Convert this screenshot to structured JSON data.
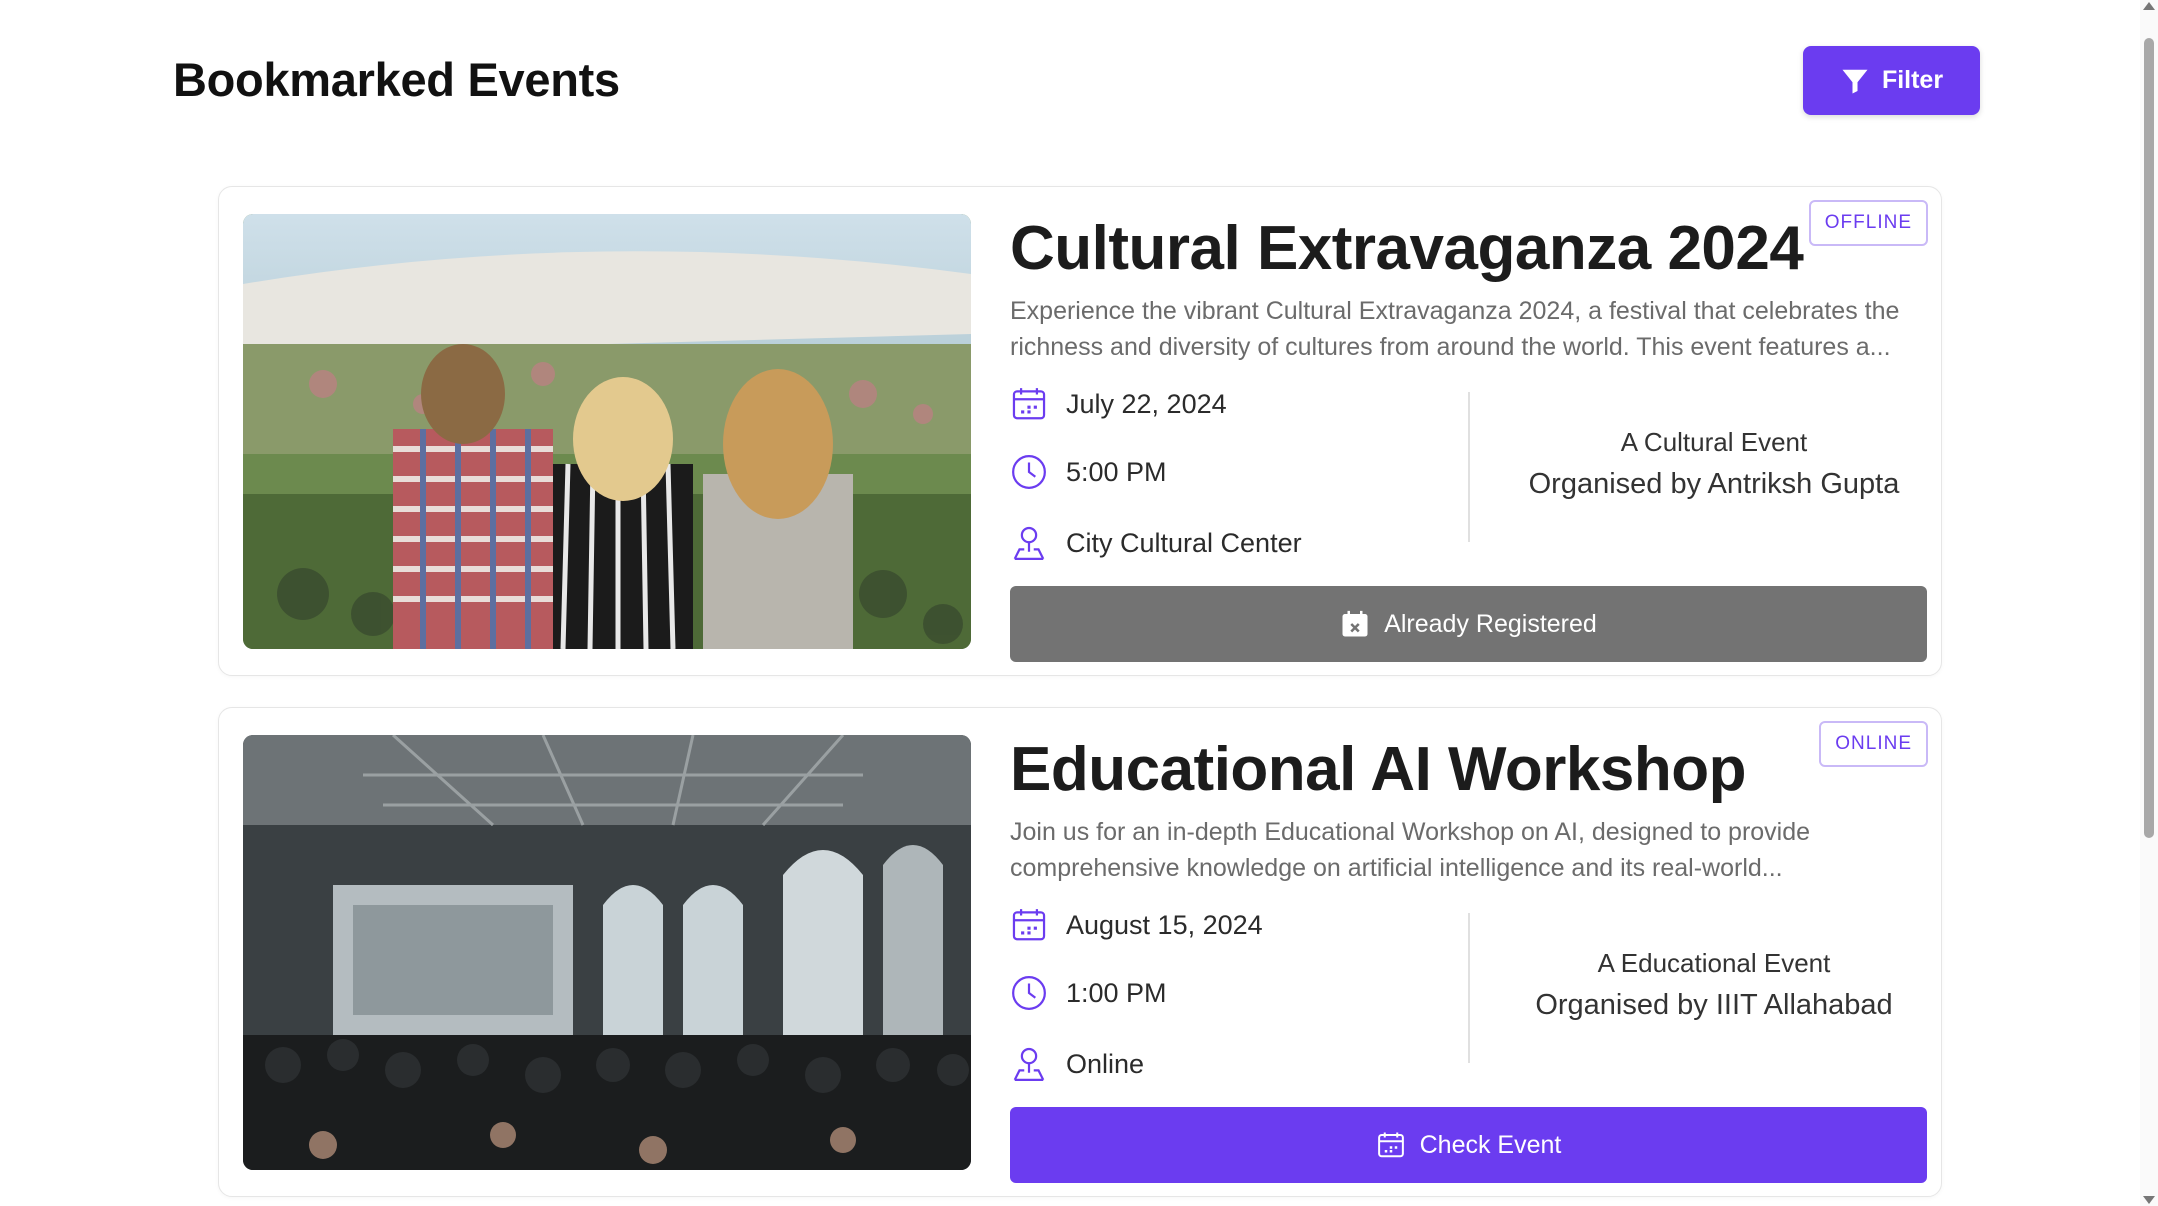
{
  "page": {
    "title": "Bookmarked Events",
    "filter_label": "Filter"
  },
  "colors": {
    "accent": "#6b3cf0",
    "registered_button": "#737373",
    "badge_border": "#c9b9f7"
  },
  "events": [
    {
      "mode": "OFFLINE",
      "title": "Cultural Extravaganza 2024",
      "description": "Experience the vibrant Cultural Extravaganza 2024, a festival that celebrates the richness and diversity of cultures from around the world. This event features a...",
      "date": "July 22, 2024",
      "time": "5:00 PM",
      "location": "City Cultural Center",
      "category": "A Cultural Event",
      "organiser": "Organised by Antriksh Gupta",
      "action_label": "Already Registered",
      "action_icon": "calendar-x-icon",
      "image": "festival-crowd-photo"
    },
    {
      "mode": "ONLINE",
      "title": "Educational AI Workshop",
      "description": "Join us for an in-depth Educational Workshop on AI, designed to provide comprehensive knowledge on artificial intelligence and its real-world...",
      "date": "August 15, 2024",
      "time": "1:00 PM",
      "location": "Online",
      "category": "A Educational Event",
      "organiser": "Organised by IIIT Allahabad",
      "action_label": "Check Event",
      "action_icon": "calendar-icon",
      "image": "workshop-hall-photo"
    }
  ]
}
